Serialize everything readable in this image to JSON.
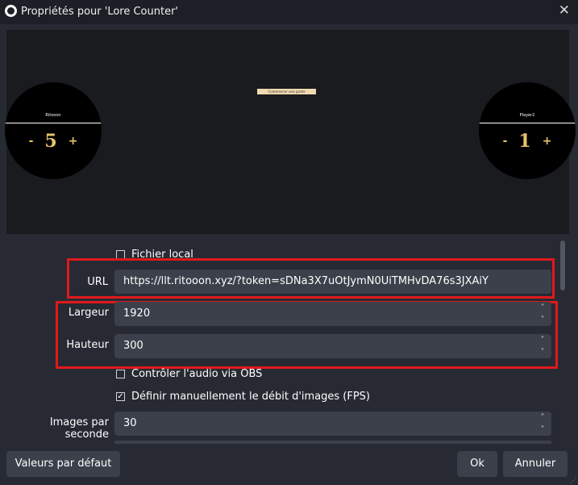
{
  "window": {
    "title": "Propriétés pour 'Lore Counter'",
    "close_glyph": "✕"
  },
  "preview": {
    "left_player": {
      "name": "Ritooon",
      "value": "5",
      "minus": "-",
      "plus": "+"
    },
    "right_player": {
      "name": "Player2",
      "value": "1",
      "minus": "-",
      "plus": "+"
    },
    "center_button": "Commencer une partie",
    "accent_color": "#e8c56a"
  },
  "form": {
    "local_file_label": "Fichier local",
    "url_label": "URL",
    "url_value": "https://llt.ritooon.xyz/?token=sDNa3X7uOtJymN0UiTMHvDA76s3JXAiY",
    "width_label": "Largeur",
    "width_value": "1920",
    "height_label": "Hauteur",
    "height_value": "300",
    "audio_label": "Contrôler l'audio via OBS",
    "fps_manual_label": "Définir manuellement le débit d'images (FPS)",
    "fps_label": "Images par seconde",
    "fps_value": "30",
    "spin_up": "˄",
    "spin_down": "˅",
    "check_glyph": "✓"
  },
  "buttons": {
    "defaults": "Valeurs par défaut",
    "ok": "Ok",
    "cancel": "Annuler"
  }
}
